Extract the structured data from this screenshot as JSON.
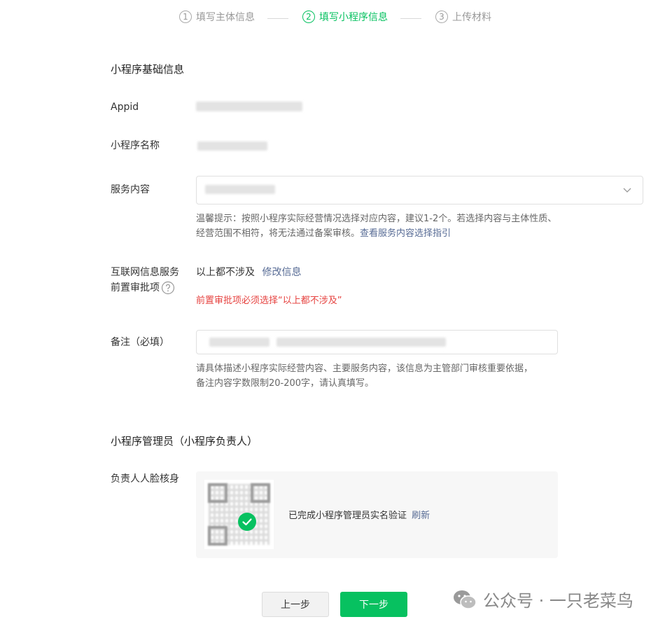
{
  "steps": [
    {
      "num": "1",
      "label": "填写主体信息",
      "active": false
    },
    {
      "num": "2",
      "label": "填写小程序信息",
      "active": true
    },
    {
      "num": "3",
      "label": "上传材料",
      "active": false
    }
  ],
  "basic": {
    "title": "小程序基础信息",
    "appid_label": "Appid",
    "name_label": "小程序名称",
    "service_label": "服务内容",
    "service_hint": "温馨提示：按照小程序实际经营情况选择对应内容，建议1-2个。若选择内容与主体性质、经营范围不相符，将无法通过备案审核。",
    "service_hint_link": "查看服务内容选择指引",
    "approval_label_line1": "互联网信息服务",
    "approval_label_line2": "前置审批项",
    "approval_value": "以上都不涉及",
    "approval_link": "修改信息",
    "approval_error": "前置审批项必须选择“以上都不涉及”",
    "remark_label": "备注（必填）",
    "remark_hint_line1": "请具体描述小程序实际经营内容、主要服务内容，该信息为主管部门审核重要依据，",
    "remark_hint_line2": "备注内容字数限制20-200字，请认真填写。"
  },
  "admin": {
    "title": "小程序管理员（小程序负责人）",
    "face_label": "负责人人脸核身",
    "verify_text": "已完成小程序管理员实名验证",
    "refresh_link": "刷新"
  },
  "buttons": {
    "prev": "上一步",
    "next": "下一步"
  },
  "watermark": "公众号 · 一只老菜鸟",
  "colors": {
    "accent": "#07c160",
    "link": "#576b95",
    "error": "#e64340"
  }
}
